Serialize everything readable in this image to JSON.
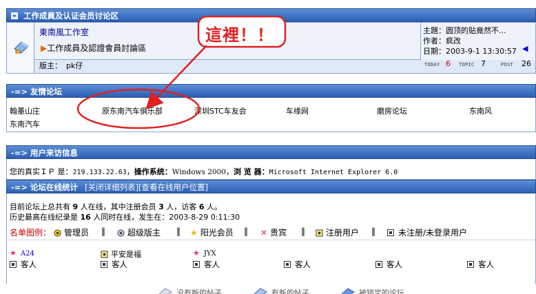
{
  "section1": {
    "title": "工作成員及认证会员讨论区",
    "forum_name": "東南風工作室",
    "subforum": "工作成員及認證會員討論區",
    "moderator_label": "版主：",
    "moderator": "pk仔",
    "topic_label": "主題：",
    "topic": "圆顶的贴竟然不...",
    "author_label": "作者：",
    "author": "疯改",
    "date_label": "日期：",
    "date": "2003-9-1 13:30:57",
    "today_label": "TODAY",
    "today_value": "6",
    "topic_count_label": "TOPIC",
    "topic_count": "7",
    "post_label": "POST",
    "post_count": "26"
  },
  "annotation": {
    "text": "這裡！！"
  },
  "friends": {
    "title": "-=> 友情论坛",
    "links": [
      "翰墨山庄",
      "原东南汽车俱乐部",
      "深圳STC车友会",
      "车缘网",
      "磨房论坛",
      "东南风",
      "东南汽车"
    ]
  },
  "visitor": {
    "title": "-=> 用户来访信息",
    "ip_label": "您的真实ＩＰ 是：",
    "ip": "219.133.22.63",
    "os_label": "操作系统：",
    "os": "Windows 2000",
    "browser_label": "浏 览 器：",
    "browser": "Microsoft Internet Explorer 6.0"
  },
  "online": {
    "title": "-=> 论坛在线统计",
    "close_link": "[关闭详细列表]",
    "view_link": "[查看在线用户位置]",
    "line1_a": "目前论坛上总共有",
    "total": "9",
    "line1_b": "人在线，其中注册会员",
    "members": "3",
    "line1_c": "人，访客",
    "guests": "6",
    "line1_d": "人。",
    "line2_a": "历史最高在线纪录是",
    "record": "16",
    "line2_b": "人同时在线，发生在：2003-8-29 0:11:30",
    "legend_label": "名单图例：",
    "legend": [
      "管理员",
      "超级版主",
      "阳光会员",
      "贵宾",
      "注册用户",
      "未注册/未登录用户"
    ],
    "sep": "‖",
    "users": [
      "A24",
      "平安是福",
      "JYX"
    ],
    "guest_label": "客人"
  },
  "bottom": {
    "items": [
      "没有新的帖子",
      "有新的帖子",
      "被锁定的论坛"
    ]
  },
  "colors": {
    "header_top": "#5b8ed6",
    "header_bottom": "#2c5fb3",
    "annotation_red": "#e02020"
  }
}
